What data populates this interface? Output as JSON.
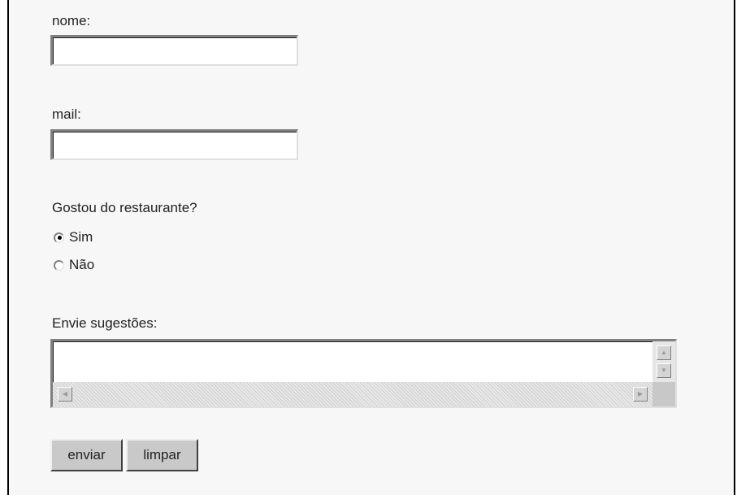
{
  "form": {
    "nome": {
      "label": "nome:",
      "value": ""
    },
    "mail": {
      "label": "mail:",
      "value": ""
    },
    "question": {
      "label": "Gostou do restaurante?",
      "options": [
        {
          "label": "Sim",
          "selected": true
        },
        {
          "label": "Não",
          "selected": false
        }
      ]
    },
    "suggestions": {
      "label": "Envie sugestões:",
      "value": ""
    },
    "buttons": {
      "submit": "enviar",
      "reset": "limpar"
    }
  },
  "icons": {
    "scroll_up": "arrow-up-icon",
    "scroll_down": "arrow-down-icon",
    "scroll_left": "arrow-left-icon",
    "scroll_right": "arrow-right-icon"
  }
}
